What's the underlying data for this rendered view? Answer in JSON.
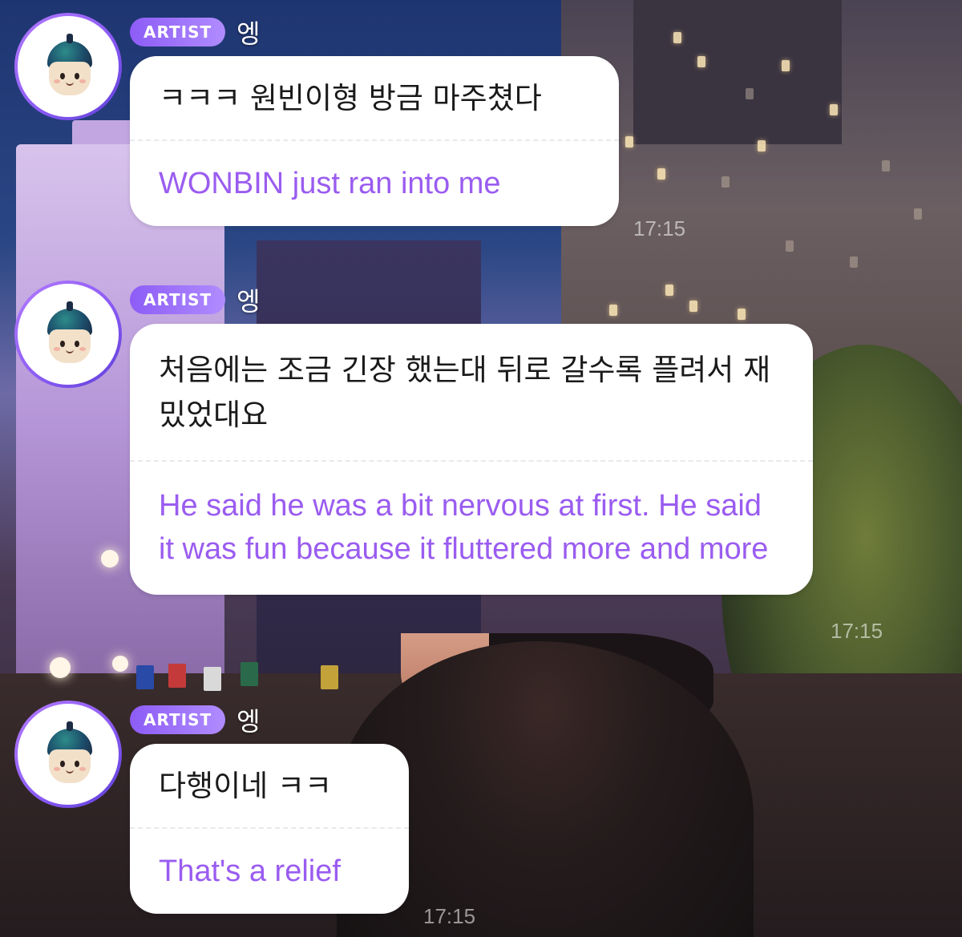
{
  "messages": [
    {
      "badge": "ARTIST",
      "sender": "엥",
      "original": "ㅋㅋㅋ 원빈이형 방금 마주쳤다",
      "translation": "WONBIN just ran into me",
      "time": "17:15"
    },
    {
      "badge": "ARTIST",
      "sender": "엥",
      "original": "처음에는 조금 긴장 했는대 뒤로 갈수록 플려서 재밌었대요",
      "translation": "He said he was a bit nervous at first. He said it was fun because it fluttered more and more",
      "time": "17:15"
    },
    {
      "badge": "ARTIST",
      "sender": "엥",
      "original": "다행이네 ㅋㅋ",
      "translation": "That's a relief",
      "time": "17:15"
    }
  ],
  "colors": {
    "badge_gradient_start": "#8d5cf6",
    "badge_gradient_end": "#b08cff",
    "translation_text": "#9a5cf0",
    "bubble_bg": "#ffffff"
  },
  "icons": {
    "avatar": "mascot-avatar-icon"
  }
}
